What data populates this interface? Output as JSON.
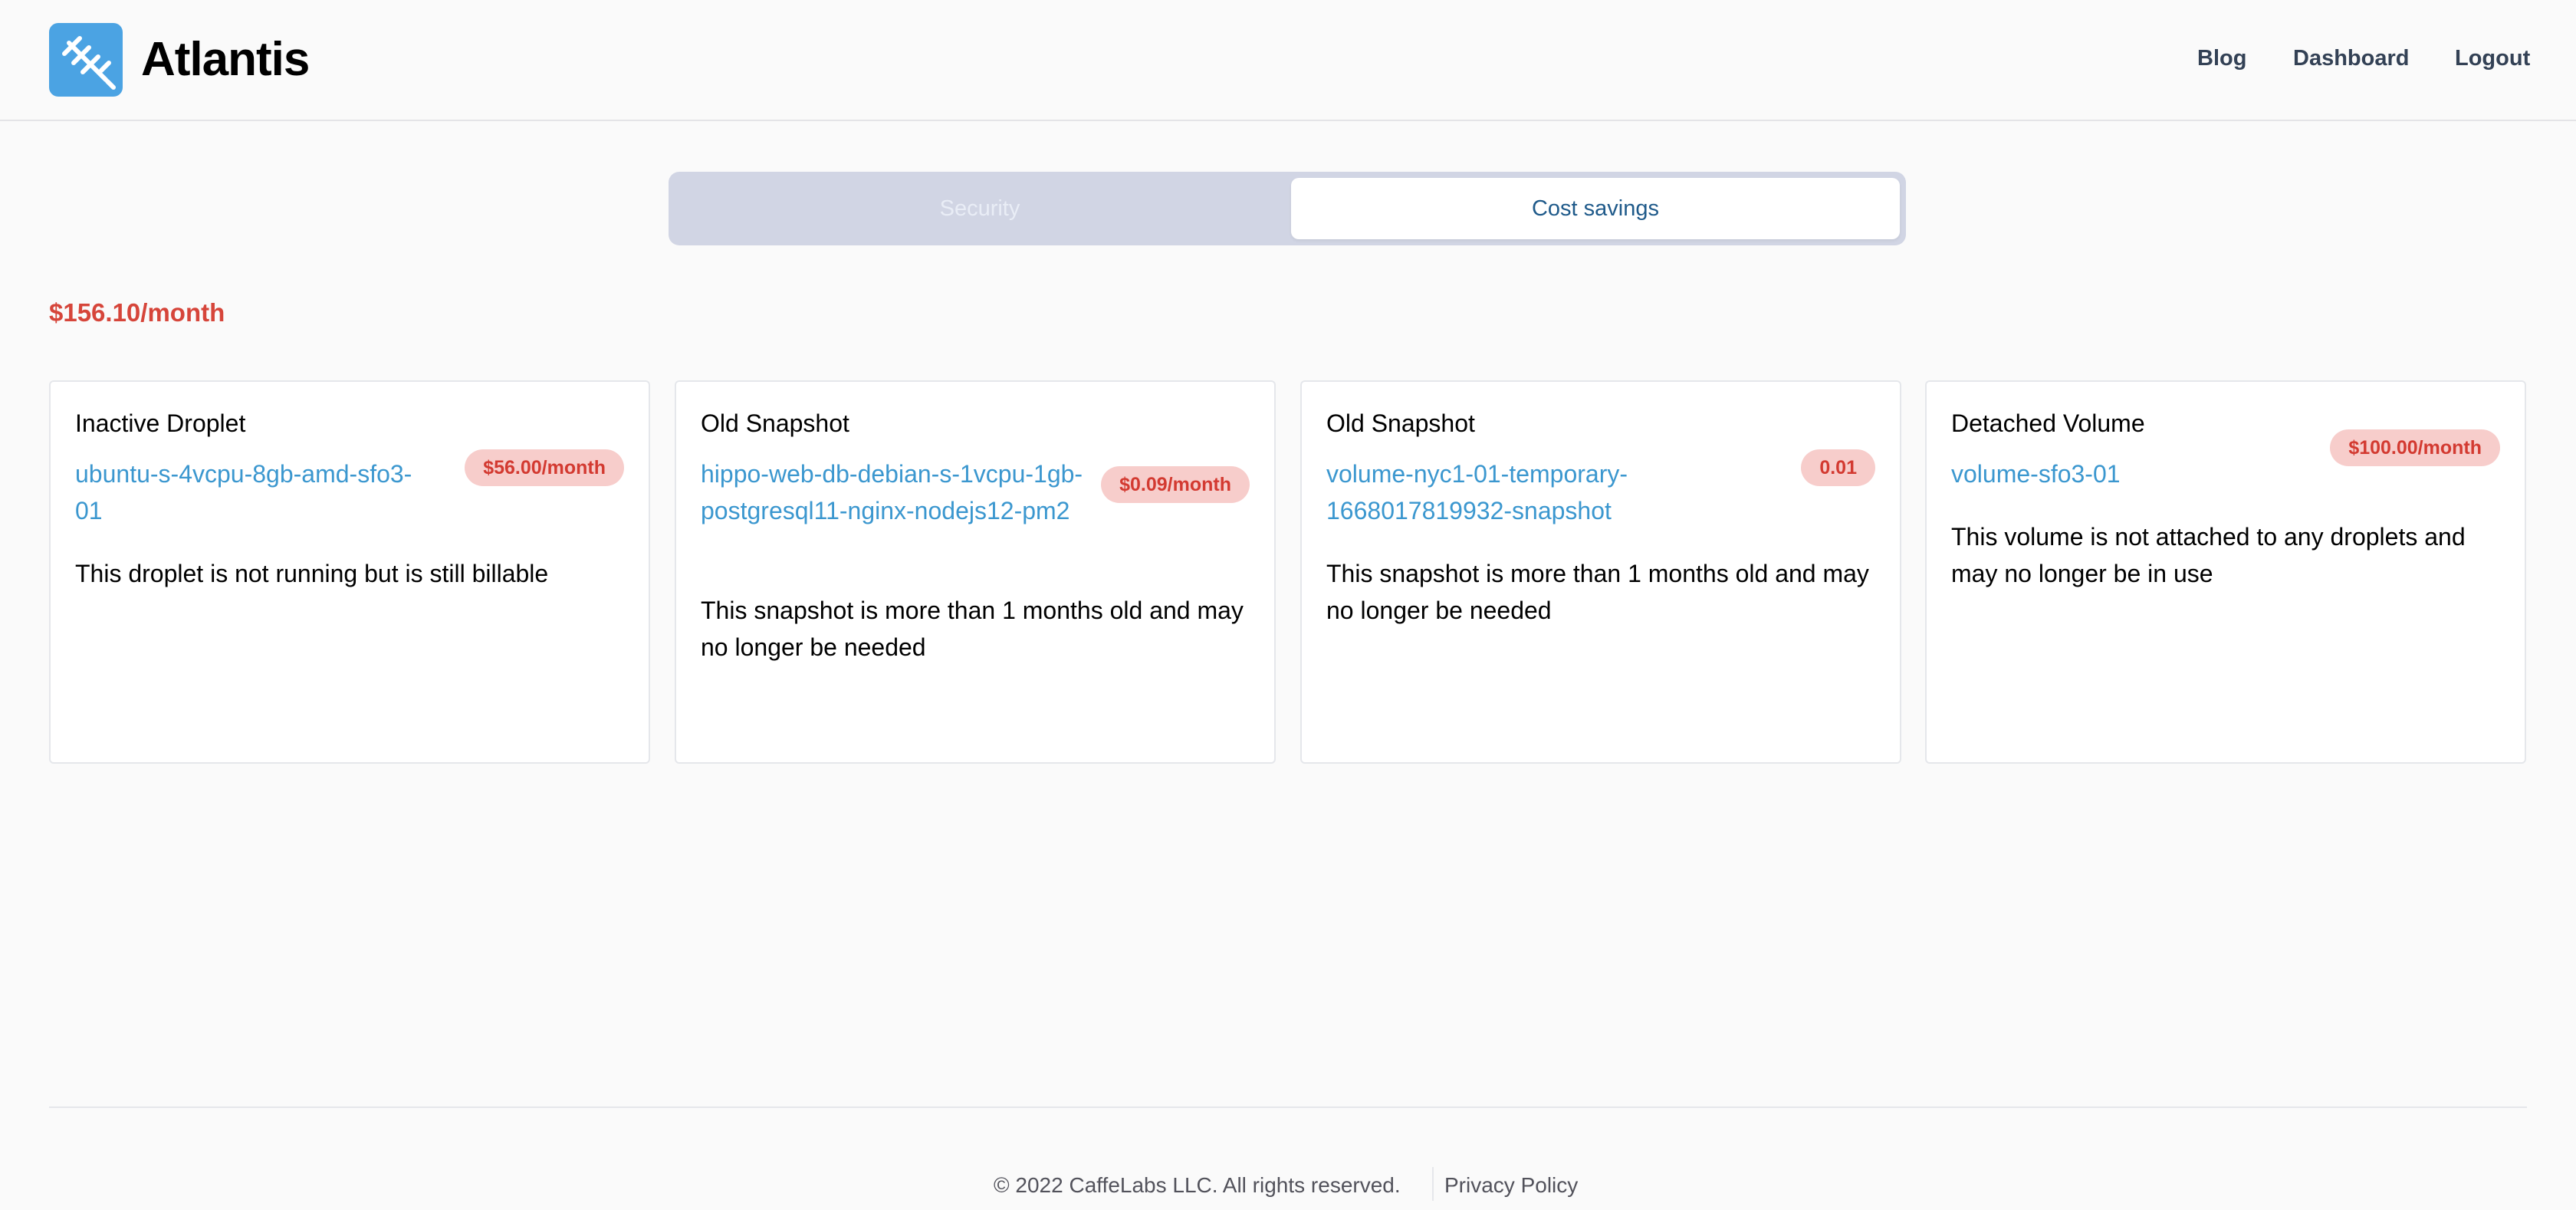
{
  "header": {
    "brand": "Atlantis",
    "logo_icon": "trident-icon",
    "nav": [
      "Blog",
      "Dashboard",
      "Logout"
    ]
  },
  "tabs": [
    {
      "label": "Security",
      "active": false
    },
    {
      "label": "Cost savings",
      "active": true
    }
  ],
  "total_savings": "$156.10/month",
  "cards": [
    {
      "title": "Inactive Droplet",
      "link": "ubuntu-s-4vcpu-8gb-amd-sfo3-01",
      "badge": "$56.00/month",
      "description": "This droplet is not running but is still billable"
    },
    {
      "title": "Old Snapshot",
      "link": "hippo-web-db-debian-s-1vcpu-1gb-postgresql11-nginx-nodejs12-pm2",
      "badge": "$0.09/month",
      "description": "This snapshot is more than 1 months old and may no longer be needed"
    },
    {
      "title": "Old Snapshot",
      "link": "volume-nyc1-01-temporary-1668017819932-snapshot",
      "badge": "0.01",
      "description": "This snapshot is more than 1 months old and may no longer be needed"
    },
    {
      "title": "Detached Volume",
      "link": "volume-sfo3-01",
      "badge": "$100.00/month",
      "description": "This volume is not attached to any droplets and may no longer be in use"
    }
  ],
  "footer": {
    "copyright": "© 2022 CaffeLabs LLC. All rights reserved.",
    "privacy": "Privacy Policy"
  },
  "colors": {
    "accent": "#4ba3e3",
    "link": "#3b97cf",
    "danger": "#d6453a",
    "badge_bg": "#f7cdcb"
  }
}
